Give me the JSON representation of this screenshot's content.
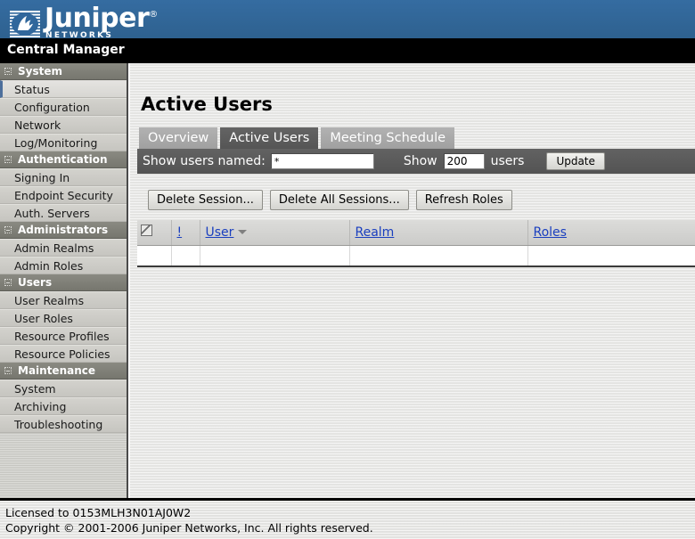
{
  "brand": {
    "name": "Juniper",
    "registered": "®",
    "tagline": "NETWORKS",
    "logo_icon": "juniper-logo-icon",
    "header_color": "#31679c"
  },
  "app": {
    "title": "Central Manager",
    "bar_color": "#000000"
  },
  "sidebar": {
    "groups": [
      {
        "label": "System",
        "icon": "minus-box-icon",
        "items": [
          {
            "label": "Status",
            "selected": true
          },
          {
            "label": "Configuration",
            "selected": false
          },
          {
            "label": "Network",
            "selected": false
          },
          {
            "label": "Log/Monitoring",
            "selected": false
          }
        ]
      },
      {
        "label": "Authentication",
        "icon": "minus-box-icon",
        "items": [
          {
            "label": "Signing In",
            "selected": false
          },
          {
            "label": "Endpoint Security",
            "selected": false
          },
          {
            "label": "Auth. Servers",
            "selected": false
          }
        ]
      },
      {
        "label": "Administrators",
        "icon": "minus-box-icon",
        "items": [
          {
            "label": "Admin Realms",
            "selected": false
          },
          {
            "label": "Admin Roles",
            "selected": false
          }
        ]
      },
      {
        "label": "Users",
        "icon": "minus-box-icon",
        "items": [
          {
            "label": "User Realms",
            "selected": false
          },
          {
            "label": "User Roles",
            "selected": false
          },
          {
            "label": "Resource Profiles",
            "selected": false
          },
          {
            "label": "Resource Policies",
            "selected": false
          }
        ]
      },
      {
        "label": "Maintenance",
        "icon": "minus-box-icon",
        "items": [
          {
            "label": "System",
            "selected": false
          },
          {
            "label": "Archiving",
            "selected": false
          },
          {
            "label": "Troubleshooting",
            "selected": false
          }
        ]
      }
    ]
  },
  "main": {
    "page_title": "Active Users",
    "tabs": [
      {
        "label": "Overview",
        "active": false
      },
      {
        "label": "Active Users",
        "active": true
      },
      {
        "label": "Meeting Schedule",
        "active": false
      }
    ],
    "filter": {
      "name_label": "Show users named:",
      "name_value": "*",
      "name_placeholder": "",
      "show_label": "Show",
      "count_value": "200",
      "count_placeholder": "",
      "users_label": "users",
      "update_label": "Update"
    },
    "actions": [
      {
        "label": "Delete Session..."
      },
      {
        "label": "Delete All Sessions..."
      },
      {
        "label": "Refresh Roles"
      }
    ],
    "table": {
      "columns": [
        {
          "label": "",
          "icon": "select-all-icon",
          "type": "icon"
        },
        {
          "label": "!",
          "type": "link"
        },
        {
          "label": "User",
          "type": "link",
          "sort": "descending",
          "sort_icon": "chevron-down-icon"
        },
        {
          "label": "Realm",
          "type": "link"
        },
        {
          "label": "Roles",
          "type": "link"
        }
      ],
      "rows": []
    }
  },
  "footer": {
    "license": "Licensed to 0153MLH3N01AJ0W2",
    "copyright": "Copyright © 2001-2006 Juniper Networks, Inc. All rights reserved."
  }
}
